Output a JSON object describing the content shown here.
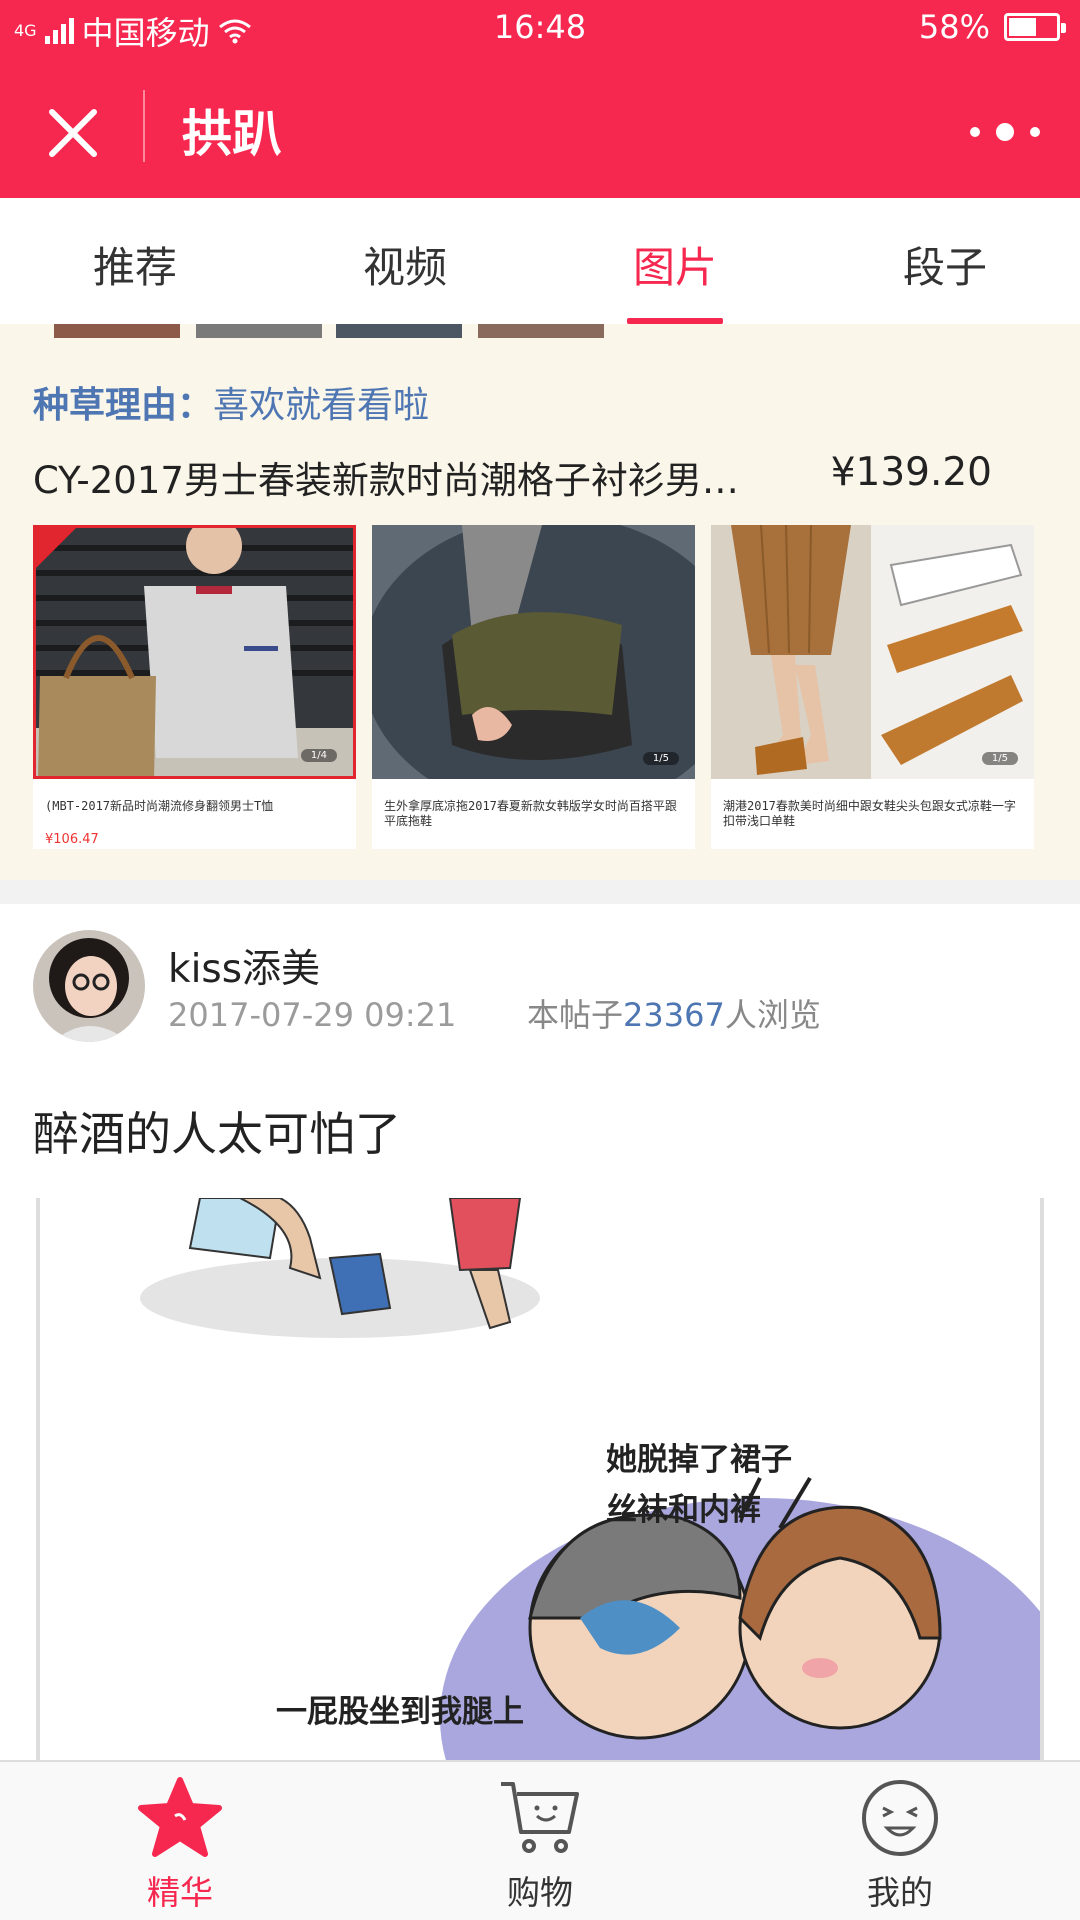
{
  "status_bar": {
    "network_tag": "4G",
    "carrier": "中国移动",
    "time": "16:48",
    "battery_percent": "58%",
    "battery_level": 0.58
  },
  "title_bar": {
    "title": "拱趴",
    "close_icon": "close-icon",
    "more_icon": "more-dots-icon"
  },
  "tabs": [
    {
      "label": "推荐",
      "active": false
    },
    {
      "label": "视频",
      "active": false
    },
    {
      "label": "图片",
      "active": true
    },
    {
      "label": "段子",
      "active": false
    }
  ],
  "shop": {
    "reason_label": "种草理由：",
    "reason_text": "喜欢就看看啦",
    "product_name": "CY-2017男士春装新款时尚潮格子衬衫男…",
    "product_price": "¥139.20",
    "cards": [
      {
        "caption": "(MBT-2017新品时尚潮流修身翻领男士T恤",
        "price": "¥106.47",
        "counter": "1/4"
      },
      {
        "caption": "生外拿厚底凉拖2017春夏新款女韩版学女时尚百搭平跟平底拖鞋",
        "price": "",
        "counter": "1/5"
      },
      {
        "caption": "潮港2017春款美时尚细中跟女鞋尖头包跟女式凉鞋一字扣带浅口单鞋",
        "price": "",
        "counter": "1/5"
      }
    ]
  },
  "post": {
    "author": "kiss添美",
    "time": "2017-07-29 09:21",
    "views_prefix": "本帖子",
    "views_count": "23367",
    "views_suffix": "人浏览",
    "title": "醉酒的人太可怕了",
    "comic_text_1": "她脱掉了裙子",
    "comic_text_2": "丝袜和内裤",
    "comic_text_3": "一屁股坐到我腿上"
  },
  "bottom_nav": [
    {
      "label": "精华",
      "icon": "star-icon",
      "active": true
    },
    {
      "label": "购物",
      "icon": "shopping-cart-icon",
      "active": false
    },
    {
      "label": "我的",
      "icon": "smiley-face-icon",
      "active": false
    }
  ],
  "colors": {
    "brand_red": "#f6284f",
    "link_blue": "#4e76b2",
    "shop_bg": "#fbf6ea"
  }
}
